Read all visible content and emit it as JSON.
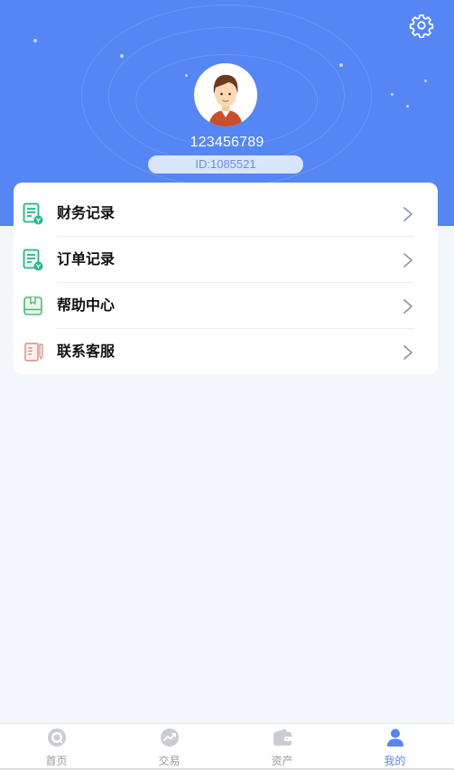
{
  "profile": {
    "username": "123456789",
    "id_text": "ID:1085521"
  },
  "icons": {
    "settings": "gear-icon",
    "avatar": "user-avatar"
  },
  "menu": {
    "items": [
      {
        "label": "财务记录",
        "icon": "finance-record-icon"
      },
      {
        "label": "订单记录",
        "icon": "order-record-icon"
      },
      {
        "label": "帮助中心",
        "icon": "help-book-icon"
      },
      {
        "label": "联系客服",
        "icon": "customer-service-icon"
      }
    ]
  },
  "tabbar": {
    "tabs": [
      {
        "label": "首页",
        "icon": "home-icon",
        "active": false
      },
      {
        "label": "交易",
        "icon": "trade-icon",
        "active": false
      },
      {
        "label": "资产",
        "icon": "wallet-icon",
        "active": false
      },
      {
        "label": "我的",
        "icon": "profile-icon",
        "active": true
      }
    ]
  },
  "colors": {
    "brand": "#5586f4",
    "background": "#f3f6fa",
    "tab_inactive": "#9a9a9a",
    "icon_green": "#2bb58a"
  }
}
